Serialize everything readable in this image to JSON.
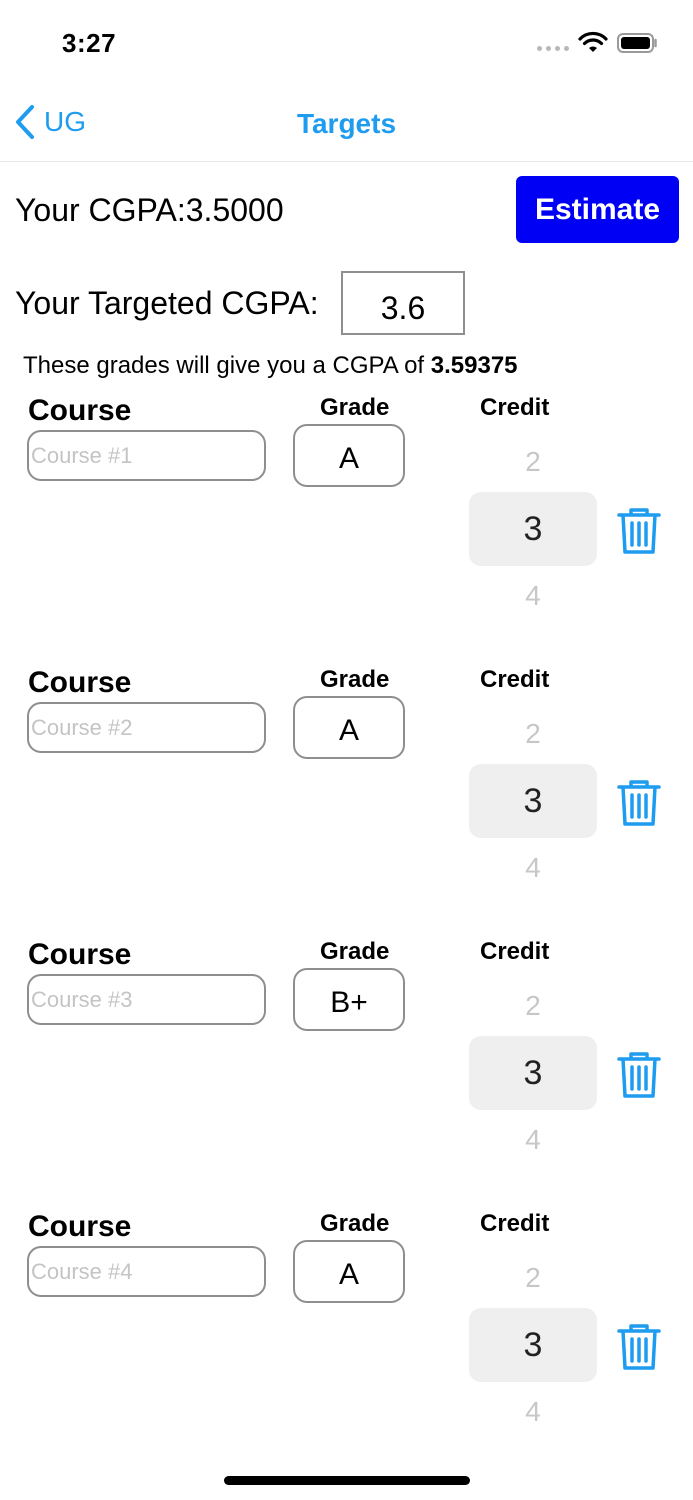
{
  "status_bar": {
    "time": "3:27"
  },
  "nav": {
    "back_label": "UG",
    "title": "Targets"
  },
  "summary": {
    "cgpa_label": "Your CGPA:3.5000",
    "estimate_label": "Estimate",
    "target_label": "Your Targeted CGPA:",
    "target_value": "3.6",
    "result_prefix": "These grades will give you  a CGPA of ",
    "result_value": "3.59375"
  },
  "columns": {
    "course": "Course",
    "grade": "Grade",
    "credit": "Credit"
  },
  "courses": [
    {
      "placeholder": "Course #1",
      "grade": "A",
      "credit_prev": "2",
      "credit": "3",
      "credit_next": "4"
    },
    {
      "placeholder": "Course #2",
      "grade": "A",
      "credit_prev": "2",
      "credit": "3",
      "credit_next": "4"
    },
    {
      "placeholder": "Course #3",
      "grade": "B+",
      "credit_prev": "2",
      "credit": "3",
      "credit_next": "4"
    },
    {
      "placeholder": "Course #4",
      "grade": "A",
      "credit_prev": "2",
      "credit": "3",
      "credit_next": "4"
    }
  ],
  "colors": {
    "accent": "#1e9cf0",
    "button": "#0000f5",
    "picker_bg": "#efefef"
  },
  "icons": [
    "wifi-icon",
    "battery-icon",
    "chevron-left-icon",
    "trash-icon"
  ]
}
